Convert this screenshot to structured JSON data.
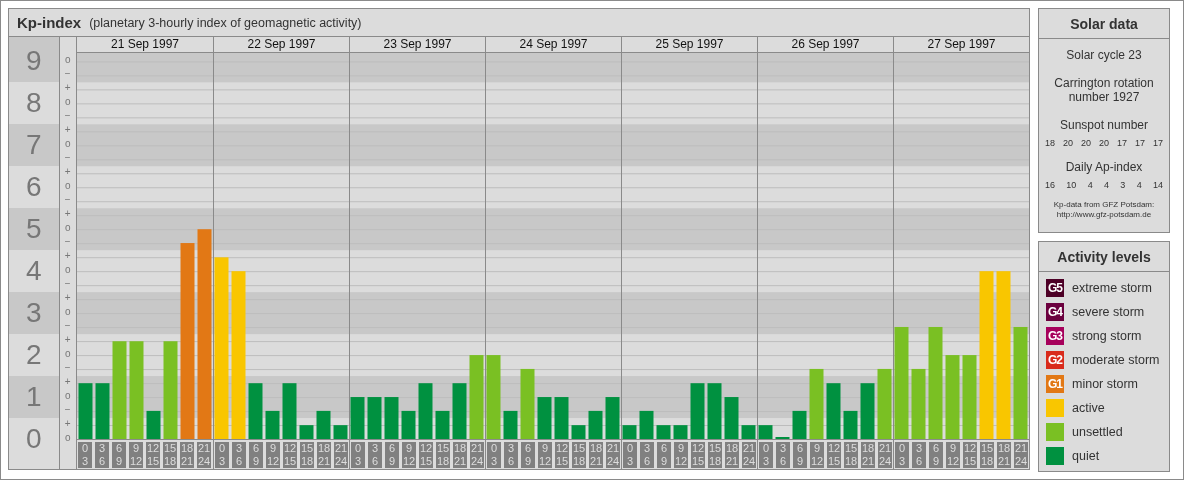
{
  "title": "Kp-index",
  "subtitle": "(planetary 3-hourly index of geomagnetic activity)",
  "y_axis": [
    {
      "ticks": [
        "o",
        "−"
      ]
    },
    {
      "ticks": [
        "+",
        "o",
        "−"
      ]
    },
    {
      "ticks": [
        "+",
        "o",
        "−"
      ]
    },
    {
      "ticks": [
        "+",
        "o",
        "−"
      ]
    },
    {
      "ticks": [
        "+",
        "o",
        "−"
      ]
    },
    {
      "ticks": [
        "+",
        "o",
        "−"
      ]
    },
    {
      "ticks": [
        "+",
        "o",
        "−"
      ]
    },
    {
      "ticks": [
        "+",
        "o",
        "−"
      ]
    },
    {
      "ticks": [
        "+",
        "o",
        "−"
      ]
    },
    {
      "ticks": [
        "+",
        "o"
      ]
    }
  ],
  "days": [
    {
      "date": "21 Sep 1997",
      "hours": [
        [
          "0",
          "3"
        ],
        [
          "3",
          "6"
        ],
        [
          "6",
          "9"
        ],
        [
          "9",
          "12"
        ],
        [
          "12",
          "15"
        ],
        [
          "15",
          "18"
        ],
        [
          "18",
          "21"
        ],
        [
          "21",
          "24"
        ]
      ]
    },
    {
      "date": "22 Sep 1997",
      "hours": [
        [
          "0",
          "3"
        ],
        [
          "3",
          "6"
        ],
        [
          "6",
          "9"
        ],
        [
          "9",
          "12"
        ],
        [
          "12",
          "15"
        ],
        [
          "15",
          "18"
        ],
        [
          "18",
          "21"
        ],
        [
          "21",
          "24"
        ]
      ]
    },
    {
      "date": "23 Sep 1997",
      "hours": [
        [
          "0",
          "3"
        ],
        [
          "3",
          "6"
        ],
        [
          "6",
          "9"
        ],
        [
          "9",
          "12"
        ],
        [
          "12",
          "15"
        ],
        [
          "15",
          "18"
        ],
        [
          "18",
          "21"
        ],
        [
          "21",
          "24"
        ]
      ]
    },
    {
      "date": "24 Sep 1997",
      "hours": [
        [
          "0",
          "3"
        ],
        [
          "3",
          "6"
        ],
        [
          "6",
          "9"
        ],
        [
          "9",
          "12"
        ],
        [
          "12",
          "15"
        ],
        [
          "15",
          "18"
        ],
        [
          "18",
          "21"
        ],
        [
          "21",
          "24"
        ]
      ]
    },
    {
      "date": "25 Sep 1997",
      "hours": [
        [
          "0",
          "3"
        ],
        [
          "3",
          "6"
        ],
        [
          "6",
          "9"
        ],
        [
          "9",
          "12"
        ],
        [
          "12",
          "15"
        ],
        [
          "15",
          "18"
        ],
        [
          "18",
          "21"
        ],
        [
          "21",
          "24"
        ]
      ]
    },
    {
      "date": "26 Sep 1997",
      "hours": [
        [
          "0",
          "3"
        ],
        [
          "3",
          "6"
        ],
        [
          "6",
          "9"
        ],
        [
          "9",
          "12"
        ],
        [
          "12",
          "15"
        ],
        [
          "15",
          "18"
        ],
        [
          "18",
          "21"
        ],
        [
          "21",
          "24"
        ]
      ]
    },
    {
      "date": "27 Sep 1997",
      "hours": [
        [
          "0",
          "3"
        ],
        [
          "3",
          "6"
        ],
        [
          "6",
          "9"
        ],
        [
          "9",
          "12"
        ],
        [
          "12",
          "15"
        ],
        [
          "15",
          "18"
        ],
        [
          "18",
          "21"
        ],
        [
          "21",
          "24"
        ]
      ]
    }
  ],
  "chart_data": {
    "type": "bar",
    "ylim": [
      0,
      9.2
    ],
    "grid": true,
    "bands": [
      {
        "axis": "y",
        "from": 0.5,
        "to": 1.5
      },
      {
        "axis": "y",
        "from": 2.5,
        "to": 3.5
      },
      {
        "axis": "y",
        "from": 4.5,
        "to": 5.5
      },
      {
        "axis": "y",
        "from": 6.5,
        "to": 7.5
      },
      {
        "axis": "y",
        "from": 8.5,
        "to": 9.2
      }
    ],
    "yticks": [
      {
        "value": 0,
        "label": "0"
      },
      {
        "value": 1,
        "label": "1"
      },
      {
        "value": 2,
        "label": "2"
      },
      {
        "value": 3,
        "label": "3"
      },
      {
        "value": 4,
        "label": "4"
      },
      {
        "value": 5,
        "label": "5"
      },
      {
        "value": 6,
        "label": "6"
      },
      {
        "value": 7,
        "label": "7"
      },
      {
        "value": 8,
        "label": "8"
      },
      {
        "value": 9,
        "label": "9"
      }
    ],
    "categories": [
      null,
      null,
      null,
      null,
      null,
      null,
      null,
      null,
      null,
      null,
      null,
      null,
      null,
      null,
      null,
      null,
      null,
      null,
      null,
      null,
      null,
      null,
      null,
      null,
      null,
      null,
      null,
      null,
      null,
      null,
      null,
      null,
      null,
      null,
      null,
      null,
      null,
      null,
      null,
      null,
      null,
      null,
      null,
      null,
      null,
      null,
      null,
      null,
      null,
      null,
      null,
      null,
      null,
      null,
      null,
      null
    ],
    "series": [
      {
        "values": [
          1.33,
          1.33,
          2.33,
          2.33,
          0.67,
          2.33,
          4.67,
          5,
          4.33,
          4,
          1.33,
          0.67,
          1.33,
          0.33,
          0.67,
          0.33,
          1,
          1,
          1,
          0.67,
          1.33,
          0.67,
          1.33,
          2,
          2,
          0.67,
          1.67,
          1,
          1,
          0.33,
          0.67,
          1,
          0.33,
          0.67,
          0.33,
          0.33,
          1.33,
          1.33,
          1,
          0.33,
          0.33,
          0,
          0.67,
          1.67,
          1.33,
          0.67,
          1.33,
          1.67,
          2.67,
          1.67,
          2.67,
          2,
          2,
          4,
          4,
          2.67
        ]
      }
    ]
  },
  "solar": {
    "title": "Solar data",
    "cycle": "Solar cycle 23",
    "rotation": [
      "Carrington rotation",
      "number 1927"
    ],
    "sunspot_title": "Sunspot number",
    "sunspot": [
      "18",
      "20",
      "20",
      "20",
      "17",
      "17",
      "17"
    ],
    "ap_title": "Daily Ap-index",
    "ap": [
      "16",
      "10",
      "4",
      "4",
      "3",
      "4",
      "14"
    ],
    "source": [
      "Kp-data from GFZ Potsdam:",
      "http://www.gfz-potsdam.de"
    ]
  },
  "activity": {
    "title": "Activity levels",
    "levels": [
      {
        "badge": "G5",
        "label": "extreme storm",
        "color": "#4d0026"
      },
      {
        "badge": "G4",
        "label": "severe storm",
        "color": "#6b003e"
      },
      {
        "badge": "G3",
        "label": "strong storm",
        "color": "#a6005b"
      },
      {
        "badge": "G2",
        "label": "moderate storm",
        "color": "#d92b1c"
      },
      {
        "badge": "G1",
        "label": "minor storm",
        "color": "#e27815"
      },
      {
        "label": "active",
        "color": "#f9c600"
      },
      {
        "label": "unsettled",
        "color": "#7ac023"
      },
      {
        "label": "quiet",
        "color": "#009140"
      }
    ]
  }
}
